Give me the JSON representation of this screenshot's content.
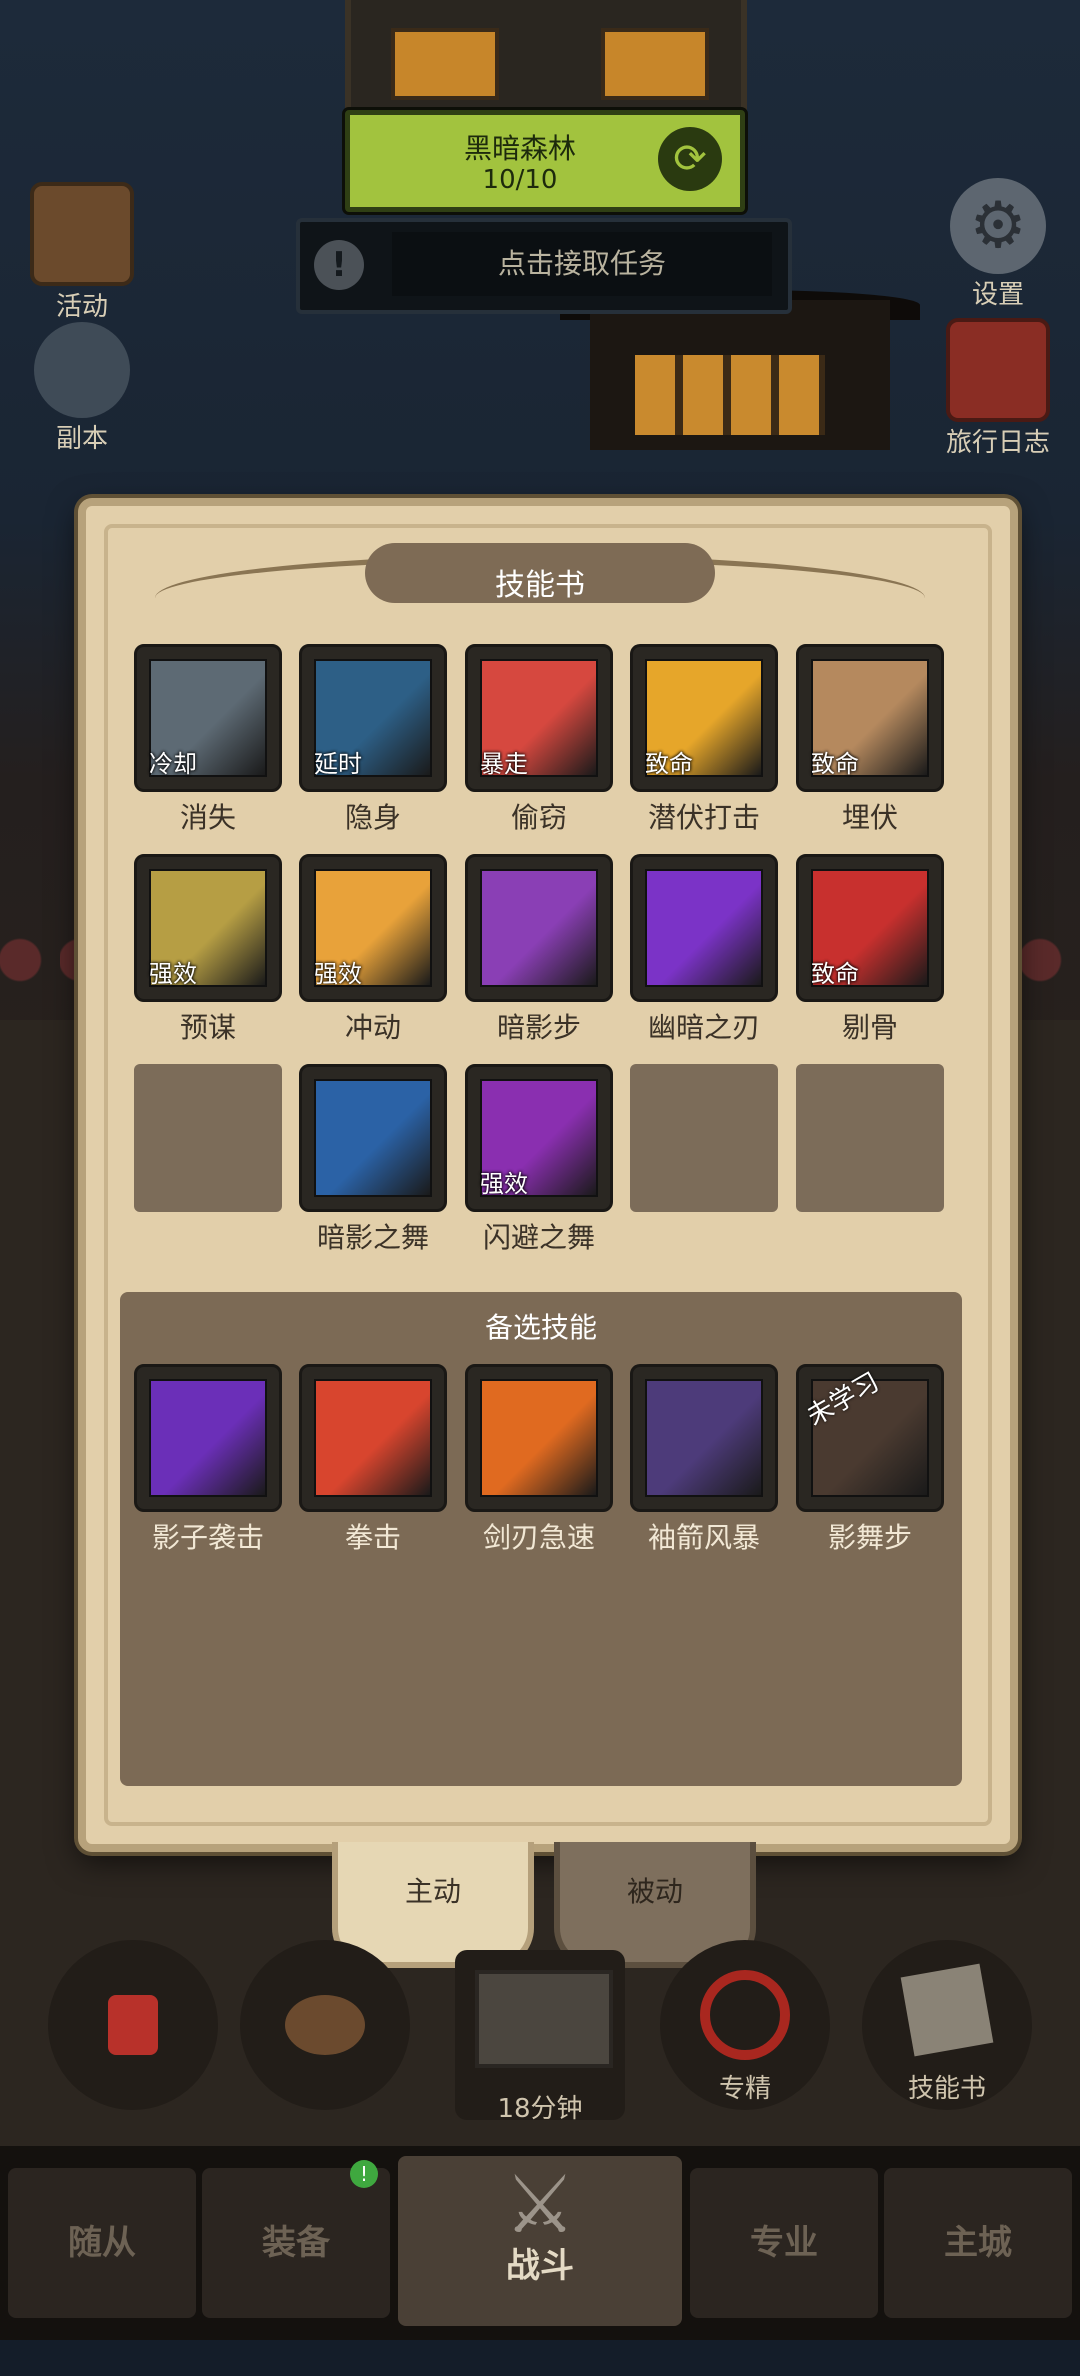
{
  "top": {
    "location_name": "黑暗森林",
    "location_progress": "10/10",
    "task_prompt": "点击接取任务",
    "left_icons": [
      {
        "label": "活动"
      },
      {
        "label": "副本"
      }
    ],
    "right_icons": [
      {
        "label": "设置"
      },
      {
        "label": "旅行日志"
      }
    ]
  },
  "panel": {
    "title": "技能书",
    "grid": [
      {
        "name": "消失",
        "badge": "冷却",
        "color": "#5d6a74"
      },
      {
        "name": "隐身",
        "badge": "延时",
        "color": "#2d5f86"
      },
      {
        "name": "偷窃",
        "badge": "暴走",
        "color": "#d6483f"
      },
      {
        "name": "潜伏打击",
        "badge": "致命",
        "color": "#e6a62a"
      },
      {
        "name": "埋伏",
        "badge": "致命",
        "color": "#b5895e"
      },
      {
        "name": "预谋",
        "badge": "强效",
        "color": "#b69e44"
      },
      {
        "name": "冲动",
        "badge": "强效",
        "color": "#e8a23a"
      },
      {
        "name": "暗影步",
        "badge": "",
        "color": "#8a3fb5"
      },
      {
        "name": "幽暗之刃",
        "badge": "",
        "color": "#7b33c7"
      },
      {
        "name": "剔骨",
        "badge": "致命",
        "color": "#c8302e"
      },
      {
        "name": "",
        "badge": "",
        "color": ""
      },
      {
        "name": "暗影之舞",
        "badge": "",
        "color": "#2b62a6"
      },
      {
        "name": "闪避之舞",
        "badge": "强效",
        "color": "#8a2fb0"
      },
      {
        "name": "",
        "badge": "",
        "color": ""
      },
      {
        "name": "",
        "badge": "",
        "color": ""
      }
    ],
    "alternate_heading": "备选技能",
    "alternates": [
      {
        "name": "影子袭击",
        "color": "#6b2fb8"
      },
      {
        "name": "拳击",
        "color": "#d8452e"
      },
      {
        "name": "剑刃急速",
        "color": "#e06a20"
      },
      {
        "name": "袖箭风暴",
        "color": "#4d3b7a"
      },
      {
        "name": "影舞步",
        "color": "#4a3a30",
        "overlay": "未学习"
      }
    ]
  },
  "tabs": {
    "active": "主动",
    "passive": "被动"
  },
  "actions": [
    {
      "label": ""
    },
    {
      "label": ""
    },
    {
      "label": "18分钟"
    },
    {
      "label": "专精"
    },
    {
      "label": "技能书"
    }
  ],
  "nav": [
    "随从",
    "装备",
    "战斗",
    "专业",
    "主城"
  ]
}
